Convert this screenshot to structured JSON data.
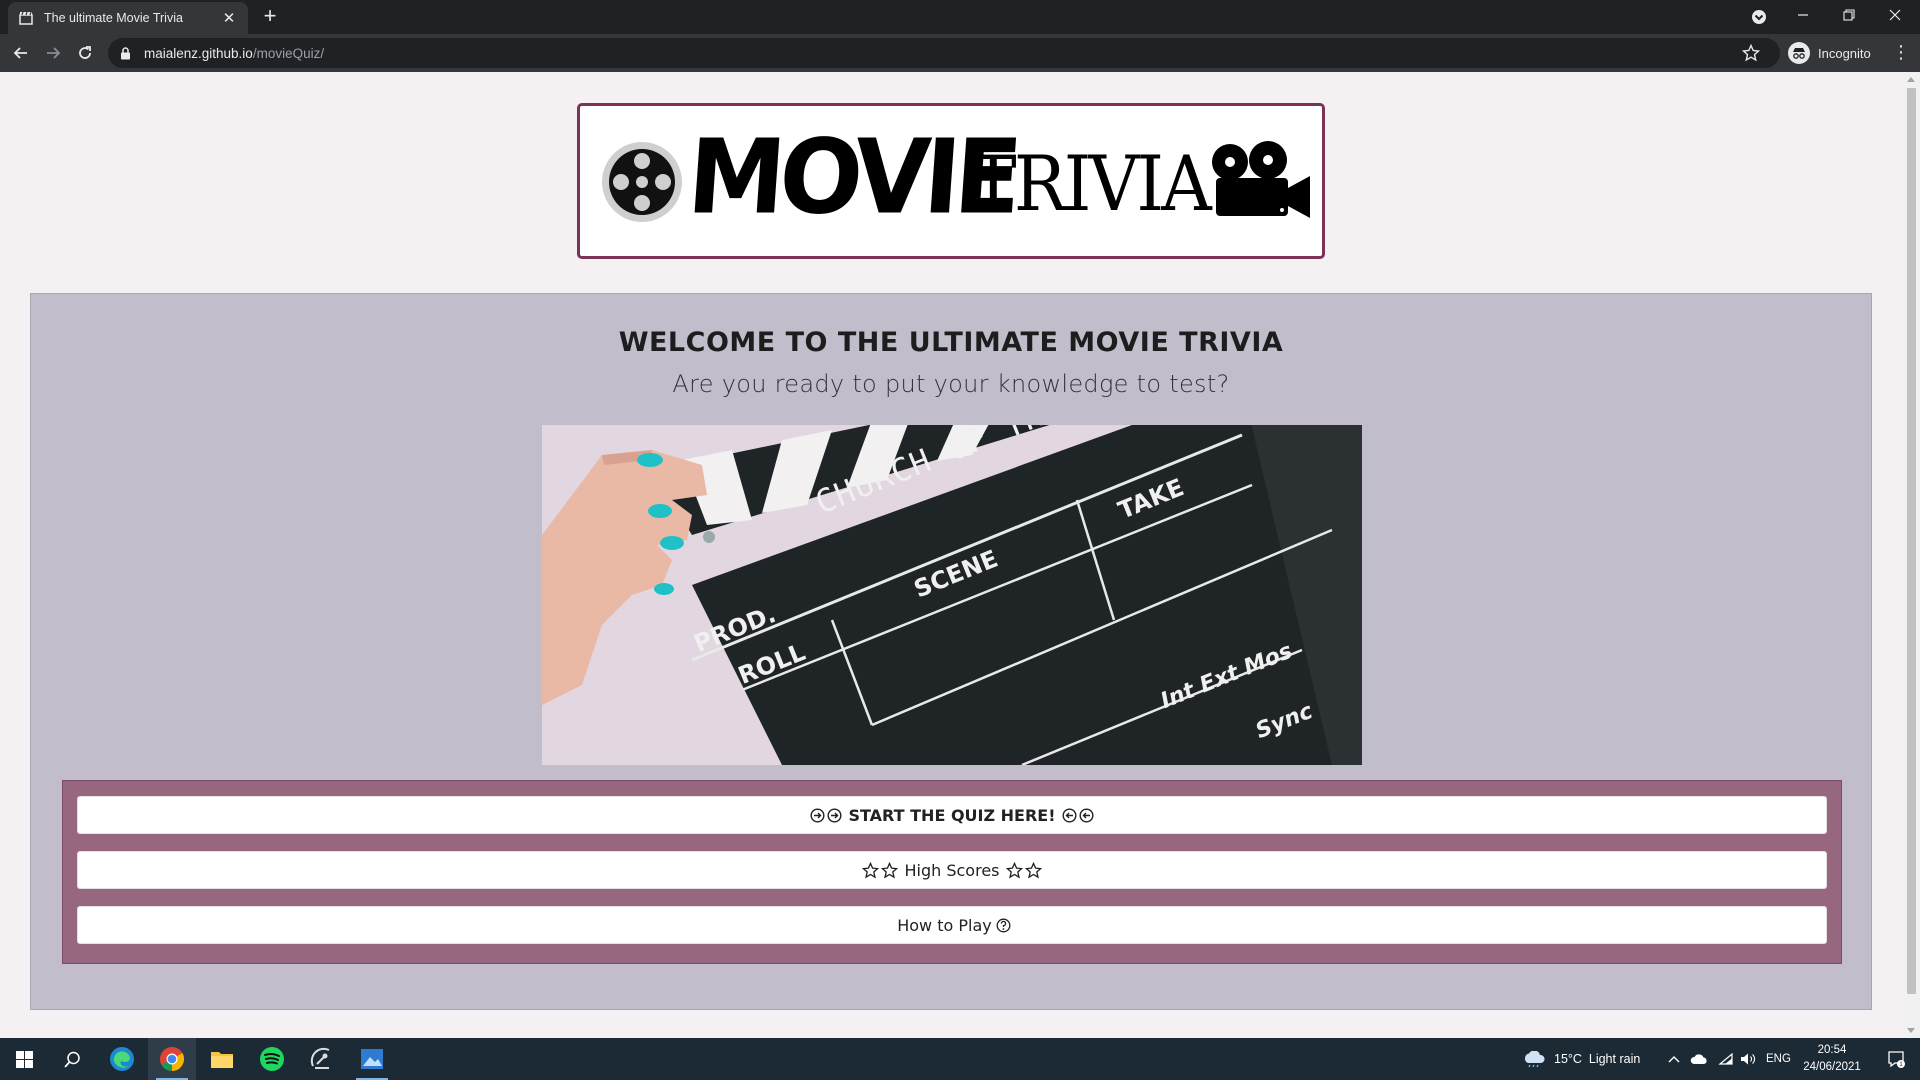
{
  "browser": {
    "tab_title": "The ultimate Movie Trivia",
    "url_host": "maialenz.github.io",
    "url_path": "/movieQuiz/",
    "profile_label": "Incognito"
  },
  "page": {
    "logo_word_1": "MOVIE",
    "logo_word_2": "TRIVIA",
    "welcome_title": "WELCOME TO THE ULTIMATE MOVIE TRIVIA",
    "tagline": "Are you ready to put your knowledge to test?",
    "clapper": {
      "prod_label": "PROD.",
      "prod_value": "CHURCH OF THE CITY NYC",
      "scene_label": "SCENE",
      "take_label": "TAKE",
      "roll_label": "ROLL",
      "corner_1": "Int Ext Mos",
      "corner_2": "Sync"
    },
    "buttons": {
      "start_label": "START THE QUIZ HERE!",
      "scores_label": "High Scores",
      "howto_label": "How to Play"
    }
  },
  "taskbar": {
    "weather": "15°C  Light rain",
    "language": "ENG",
    "time": "20:54",
    "date": "24/06/2021"
  },
  "colors": {
    "logo_border": "#7a3257",
    "panel_bg": "#c2bdca",
    "button_panel_bg": "#97677f"
  }
}
